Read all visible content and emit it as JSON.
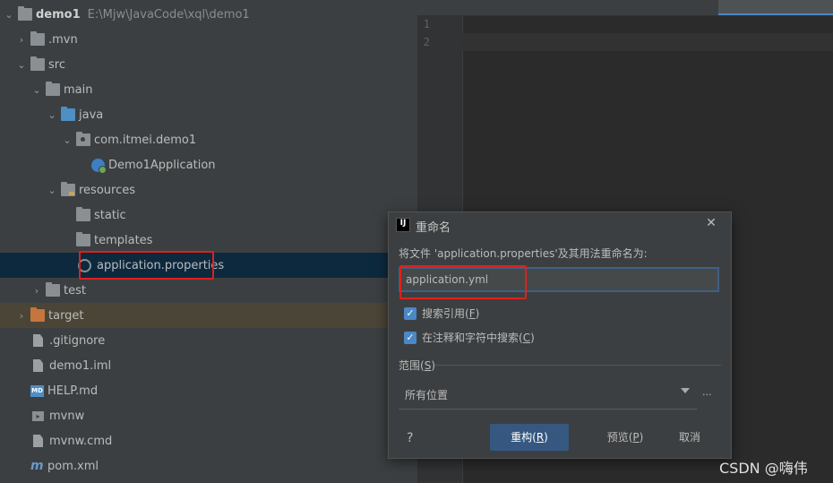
{
  "project": {
    "root_name": "demo1",
    "root_path": "E:\\Mjw\\JavaCode\\xql\\demo1",
    "items": [
      {
        "label": ".mvn"
      },
      {
        "label": "src"
      },
      {
        "label": "main"
      },
      {
        "label": "java"
      },
      {
        "label": "com.itmei.demo1"
      },
      {
        "label": "Demo1Application"
      },
      {
        "label": "resources"
      },
      {
        "label": "static"
      },
      {
        "label": "templates"
      },
      {
        "label": "application.properties"
      },
      {
        "label": "test"
      },
      {
        "label": "target"
      },
      {
        "label": ".gitignore"
      },
      {
        "label": "demo1.iml"
      },
      {
        "label": "HELP.md"
      },
      {
        "label": "mvnw"
      },
      {
        "label": "mvnw.cmd"
      },
      {
        "label": "pom.xml"
      }
    ]
  },
  "editor": {
    "line_numbers": [
      "1",
      "2"
    ]
  },
  "dialog": {
    "title": "重命名",
    "close_glyph": "✕",
    "logo_text": "IJ",
    "prompt": "将文件 'application.properties'及其用法重命名为:",
    "new_name": "application.yml",
    "search_refs_label": "搜索引用(",
    "search_refs_key": "F",
    "search_refs_end": ")",
    "search_comments_label": "在注释和字符中搜索(",
    "search_comments_key": "C",
    "search_comments_end": ")",
    "scope_label": "范围(",
    "scope_key": "S",
    "scope_end": ")",
    "scope_value": "所有位置",
    "more_glyph": "...",
    "help_glyph": "?",
    "refactor_label": "重构(",
    "refactor_key": "R",
    "refactor_end": ")",
    "preview_label": "预览(",
    "preview_key": "P",
    "preview_end": ")",
    "cancel_label": "取消"
  },
  "watermark": "CSDN @嗨伟",
  "colors": {
    "accent": "#4a88c7",
    "primary_button": "#365880",
    "highlight_box": "#e0201c"
  }
}
